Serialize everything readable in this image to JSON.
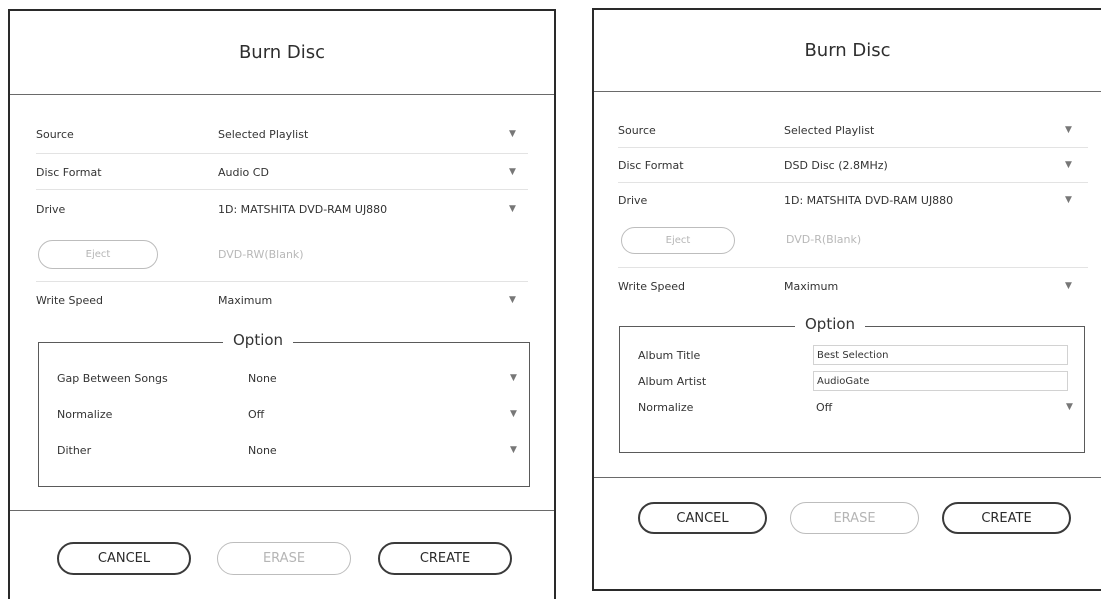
{
  "left_dialog": {
    "title": "Burn Disc",
    "source": {
      "label": "Source",
      "value": "Selected Playlist"
    },
    "disc_format": {
      "label": "Disc Format",
      "value": "Audio CD"
    },
    "drive": {
      "label": "Drive",
      "value": "1D: MATSHITA DVD-RAM UJ880"
    },
    "eject_label": "Eject",
    "media_status": "DVD-RW(Blank)",
    "write_speed": {
      "label": "Write Speed",
      "value": "Maximum"
    },
    "option": {
      "legend": "Option",
      "gap": {
        "label": "Gap Between Songs",
        "value": "None"
      },
      "normalize": {
        "label": "Normalize",
        "value": "Off"
      },
      "dither": {
        "label": "Dither",
        "value": "None"
      }
    },
    "buttons": {
      "cancel": "CANCEL",
      "erase": "ERASE",
      "create": "CREATE"
    }
  },
  "right_dialog": {
    "title": "Burn Disc",
    "source": {
      "label": "Source",
      "value": "Selected Playlist"
    },
    "disc_format": {
      "label": "Disc Format",
      "value": "DSD Disc (2.8MHz)"
    },
    "drive": {
      "label": "Drive",
      "value": "1D: MATSHITA DVD-RAM UJ880"
    },
    "eject_label": "Eject",
    "media_status": "DVD-R(Blank)",
    "write_speed": {
      "label": "Write Speed",
      "value": "Maximum"
    },
    "option": {
      "legend": "Option",
      "album_title": {
        "label": "Album Title",
        "value": "Best Selection"
      },
      "album_artist": {
        "label": "Album Artist",
        "value": "AudioGate"
      },
      "normalize": {
        "label": "Normalize",
        "value": "Off"
      }
    },
    "buttons": {
      "cancel": "CANCEL",
      "erase": "ERASE",
      "create": "CREATE"
    }
  },
  "icons": {
    "dropdown": "dropdown-arrow-icon"
  },
  "colors": {
    "border": "#2a2a2a",
    "disabled": "#b8b8b8",
    "background": "#ffffff"
  }
}
